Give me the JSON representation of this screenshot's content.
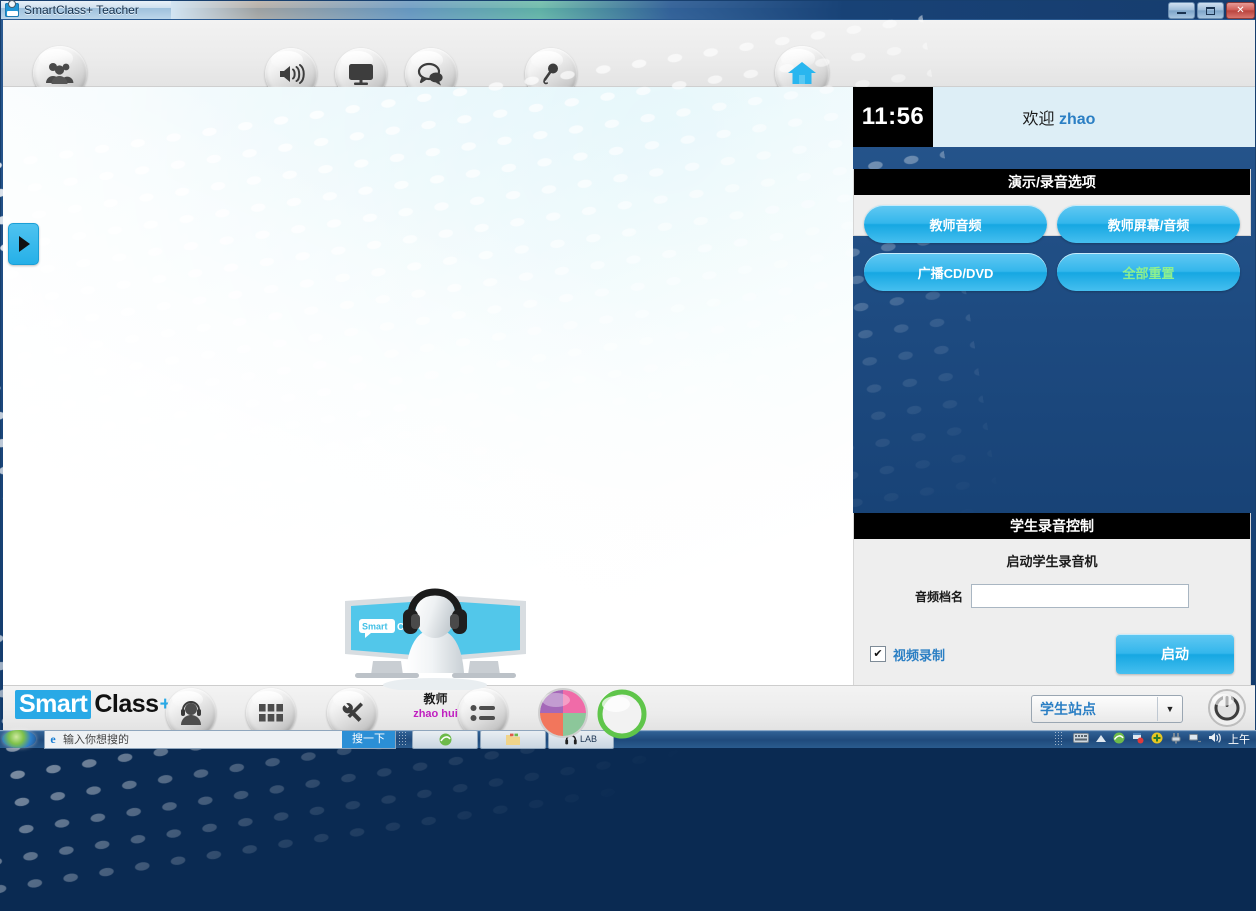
{
  "window": {
    "title": "SmartClass+ Teacher",
    "icon": "smartclass-lab-icon",
    "minimize_label": "–",
    "maximize_label": "□",
    "close_label": "✕"
  },
  "toolbar_top": {
    "items": [
      {
        "name": "group-students-icon",
        "label": "Group"
      },
      {
        "name": "speaker-audio-icon",
        "label": "Audio"
      },
      {
        "name": "monitor-screen-icon",
        "label": "Screen"
      },
      {
        "name": "chat-bubbles-icon",
        "label": "Chat"
      },
      {
        "name": "microphone-icon",
        "label": "Microphone"
      },
      {
        "name": "home-icon",
        "label": "Home"
      }
    ]
  },
  "welcome": {
    "clock": "11:56",
    "greeting": "欢迎",
    "user": "zhao"
  },
  "demo_panel": {
    "title": "演示/录音选项",
    "buttons": [
      {
        "label": "教师音频",
        "style": "white"
      },
      {
        "label": "教师屏幕/音频",
        "style": "white"
      },
      {
        "label": "广播CD/DVD",
        "style": "white"
      },
      {
        "label": "全部重置",
        "style": "green"
      }
    ]
  },
  "record_panel": {
    "title": "学生录音控制",
    "subtitle": "启动学生录音机",
    "file_label": "音频档名",
    "file_value": "",
    "file_placeholder": "",
    "checkbox_label": "视频录制",
    "checkbox_checked": "✔",
    "start_label": "启动"
  },
  "stage": {
    "teacher_role": "教师",
    "teacher_name": "zhao hui",
    "monitor_logo": "Smart Class+",
    "side_tab_icon": "expand-right-arrow-icon"
  },
  "toolbar_bottom": {
    "logo_part1": "Smart",
    "logo_part2": "Class",
    "logo_plus": "+",
    "items": [
      {
        "name": "student-headset-icon",
        "label": "Student"
      },
      {
        "name": "grid-layout-icon",
        "label": "Layout"
      },
      {
        "name": "tools-wrench-icon",
        "label": "Tools"
      },
      {
        "name": "list-icon",
        "label": "List"
      },
      {
        "name": "color-wheel-icon",
        "label": "Groups"
      },
      {
        "name": "green-ring-icon",
        "label": "Status"
      }
    ],
    "select_value": "学生站点",
    "select_arrow": "▼",
    "power_label": "Power"
  },
  "taskbar": {
    "search_placeholder": "输入你想搜的",
    "search_button": "搜一下",
    "items": [
      {
        "name": "taskbar-item-browser",
        "label": ""
      },
      {
        "name": "taskbar-item-folder",
        "label": ""
      },
      {
        "name": "taskbar-item-lab",
        "label": "LAB"
      }
    ],
    "clock_period": "上午"
  },
  "colors": {
    "accent_blue": "#29a9e6",
    "panel_header": "#000000",
    "welcome_bg": "#ddeef6",
    "green_text": "#8ef08e",
    "name_magenta": "#c020c0"
  }
}
